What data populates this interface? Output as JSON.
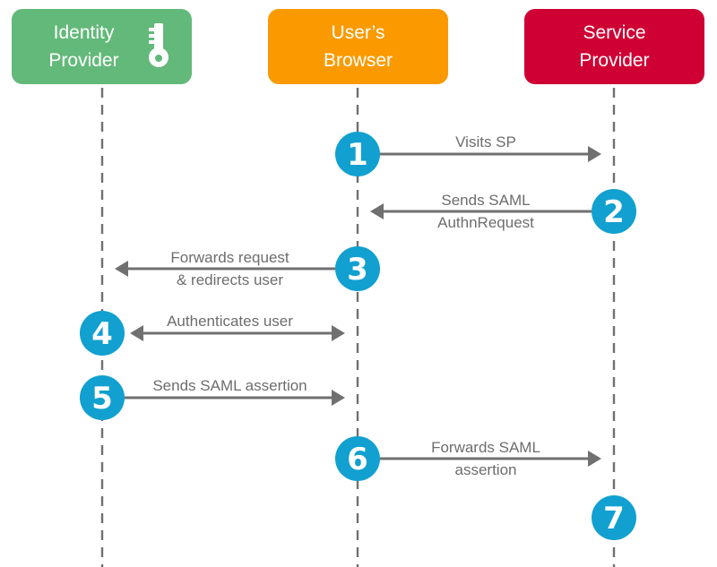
{
  "colors": {
    "idp": "#63b97a",
    "browser": "#fa9a00",
    "sp": "#cf0134",
    "step": "#11a0cf",
    "arrow": "#707070",
    "lifeline": "#707070",
    "text": "#6d6d6d"
  },
  "actors": [
    {
      "id": "idp",
      "label": "Identity\nProvider",
      "icon": "key-icon"
    },
    {
      "id": "browser",
      "label": "User’s\nBrowser"
    },
    {
      "id": "sp",
      "label": "Service\nProvider"
    }
  ],
  "steps": [
    {
      "number": "1",
      "label": "Visits SP",
      "from": "browser",
      "to": "sp",
      "at": "browser"
    },
    {
      "number": "2",
      "label": "Sends SAML\nAuthnRequest",
      "from": "sp",
      "to": "browser",
      "at": "sp"
    },
    {
      "number": "3",
      "label": "Forwards request\n& redirects user",
      "from": "browser",
      "to": "idp",
      "at": "browser"
    },
    {
      "number": "4",
      "label": "Authenticates user",
      "from": "idp",
      "to": "browser",
      "at": "idp",
      "bidirectional": true
    },
    {
      "number": "5",
      "label": "Sends SAML assertion",
      "from": "idp",
      "to": "browser",
      "at": "idp"
    },
    {
      "number": "6",
      "label": "Forwards SAML\nassertion",
      "from": "browser",
      "to": "sp",
      "at": "browser"
    },
    {
      "number": "7",
      "label": "",
      "at": "sp"
    }
  ]
}
